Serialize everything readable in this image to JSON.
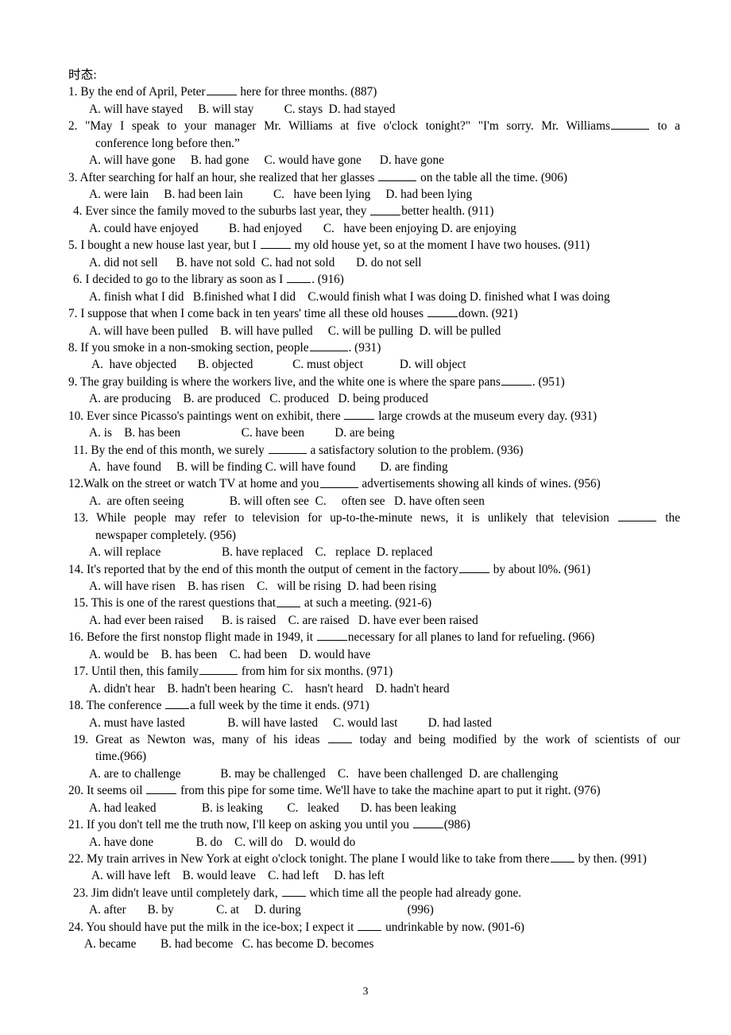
{
  "document": {
    "heading": "时态:",
    "page_number": "3"
  },
  "questions": [
    {
      "number": "1.",
      "stem_before": "By the end of April, Peter",
      "stem_after": "here for three months. (887)",
      "source": "(887)",
      "options": "A. will have stayed     B. will stay          C. stays  D. had stayed"
    },
    {
      "number": "2.",
      "stem_before": "\"May I speak to your manager Mr. Williams at five o'clock tonight?\" \"I'm sorry. Mr. Williams",
      "stem_after": "to a",
      "stem_continued": "conference long before then.”",
      "options": "A. will have gone     B. had gone     C. would have gone      D. have gone"
    },
    {
      "number": "3.",
      "stem_before": "After searching for half an hour, she realized that her glasses",
      "stem_after": "on the table all the time. (906)",
      "options": "A. were lain     B. had been lain          C.   have been lying     D. had been lying"
    },
    {
      "number": "4.",
      "stem_before": "Ever since the family moved to the suburbs last year, they",
      "stem_after": "better health.   (911)",
      "options": "A. could have enjoyed          B. had enjoyed       C.   have been enjoying D. are enjoying"
    },
    {
      "number": "5.",
      "stem_before": "I bought a new house last year, but I",
      "stem_after": "my old house yet, so at the moment I have two houses.     (911)",
      "options": "A. did not sell      B. have not sold  C. had not sold       D. do not sell"
    },
    {
      "number": "6.",
      "stem_before": "  I decided to go to the library as soon as I",
      "stem_after": ". (916)",
      "options": "A. finish what I did   B.finished what I did    C.would finish what I was doing D. finished what I was doing"
    },
    {
      "number": "7.",
      "stem_before": "I suppose that when I come back in ten years' time all these old houses",
      "stem_after": "down. (921)",
      "options": "A. will have been pulled    B. will have pulled     C. will be pulling  D. will be pulled"
    },
    {
      "number": "8.",
      "stem_before": "If you smoke in a non-smoking section, people",
      "stem_after": ". (931)",
      "options": " A.  have objected       B. objected             C. must object            D. will object"
    },
    {
      "number": "9.",
      "stem_before": "The gray building is where the workers live, and the white one is where the spare pans",
      "stem_after": ". (951)",
      "options": "A. are producing    B. are produced   C. produced   D. being produced"
    },
    {
      "number": "10.",
      "stem_before": "Ever since Picasso's paintings went on exhibit, there",
      "stem_after": "large crowds at the museum every day. (931)",
      "options": "A. is    B. has been                    C. have been          D. are being"
    },
    {
      "number": "11.",
      "stem_before": "By the end of this month, we surely",
      "stem_after": "a satisfactory solution to the problem.    (936)",
      "options": "A.  have found     B. will be finding C. will have found        D. are finding"
    },
    {
      "number": "12.",
      "stem_before": "Walk on the street or watch TV at home and you",
      "stem_after": "advertisements showing all kinds of wines. (956)",
      "options": "A.  are often seeing               B. will often see  C.     often see   D. have often seen"
    },
    {
      "number": "13.",
      "stem_before": "While people may refer to television for up-to-the-minute news, it is unlikely that television",
      "stem_after": "the",
      "stem_continued": "newspaper completely. (956)",
      "options": "A. will replace                    B. have replaced    C.   replace  D. replaced"
    },
    {
      "number": "14.",
      "stem_before": "It's reported that by the end of this month the output of cement in the factory",
      "stem_after": "by about l0%. (961)",
      "options": "A. will have risen    B. has risen    C.   will be rising  D. had been rising"
    },
    {
      "number": "15.",
      "stem_before": "This is one of the rarest questions that",
      "stem_after": "at such a meeting. (921-6)",
      "options": "A. had ever been raised      B. is raised    C. are raised   D. have ever been raised"
    },
    {
      "number": "16.",
      "stem_before": "Before the first nonstop flight made in 1949, it",
      "stem_after": "necessary for all planes to land for refueling. (966)",
      "options": "A. would be    B. has been    C. had been    D. would have"
    },
    {
      "number": "17.",
      "stem_before": "Until then, this family",
      "stem_after": "from him for six months. (971)",
      "options": "A. didn't hear    B. hadn't been hearing  C.    hasn't heard    D. hadn't heard"
    },
    {
      "number": "18.",
      "stem_before": "The conference",
      "stem_after": "a full week by the time it ends. (971)",
      "options": "A. must have lasted              B. will have lasted     C. would last          D. had lasted"
    },
    {
      "number": "19.",
      "stem_before": "Great as Newton was, many of his ideas",
      "stem_after": "today and being modified by the work of scientists of our",
      "stem_continued": "time.(966)",
      "options": "A. are to challenge             B. may be challenged    C.   have been challenged  D. are challenging"
    },
    {
      "number": "20.",
      "stem_before": "It seems oil",
      "stem_after": "from this pipe for some time. We'll have to take the machine apart to put it right. (976)",
      "options": "A. had leaked               B. is leaking        C.   leaked       D. has been leaking"
    },
    {
      "number": "21.",
      "stem_before": "If you don't tell me the truth now, I'll keep on asking you until you",
      "stem_after": "(986)",
      "options": "A. have done              B. do    C. will do    D. would do"
    },
    {
      "number": "22.",
      "stem_before": "My train arrives in New York at eight o'clock tonight. The plane I would like to take from there",
      "stem_after": "by then. (991)",
      "options": " A. will have left    B. would leave    C. had left     D. has left"
    },
    {
      "number": "23.",
      "stem_before": "Jim didn't leave until completely dark,",
      "stem_after": "which time all the people had already gone.",
      "options": "A. after       B. by              C. at     D. during                                   (996)"
    },
    {
      "number": "24.",
      "stem_before": "You should have put the milk in the ice-box; I expect it",
      "stem_after": "undrinkable by now. (901-6)",
      "options": "A. became        B. had become   C. has become D. becomes"
    }
  ]
}
